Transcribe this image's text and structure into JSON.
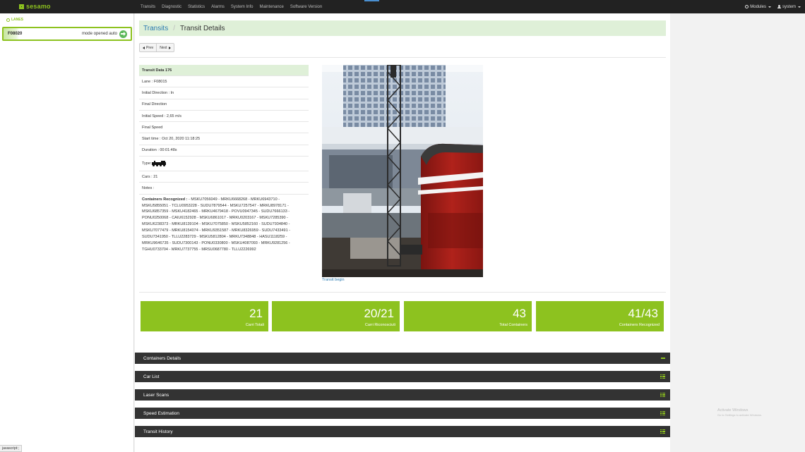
{
  "brand": {
    "name": "sesamo",
    "accent": "#8dc21f"
  },
  "nav": {
    "items": [
      "Transits",
      "Diagnostic",
      "Statistics",
      "Alarms",
      "System Info",
      "Maintenance",
      "Software Version"
    ],
    "modules_label": "Modules",
    "user_label": "system"
  },
  "sidebar": {
    "title": "LANES",
    "lane": {
      "id": "F08020",
      "status": "mode opened auto"
    }
  },
  "breadcrumb": {
    "link": "Transits",
    "current": "Transit Details"
  },
  "pager": {
    "prev": "Prev",
    "next": "Next"
  },
  "details": {
    "header": "Transit Data 176",
    "lane": "Lane : F08015",
    "initial_direction": "Initial Direction : In",
    "final_direction": "Final Direction",
    "initial_speed": "Initial Speed : 2,65 m/s",
    "final_speed": "Final Speed",
    "start_time": "Start time : Oct 20, 2020 11:18:25",
    "duration": "Duration : 00:01:48s",
    "type_label": "Type:",
    "type_icon": "locomotive-icon",
    "cars": "Cars : 21",
    "notes": "Notes :",
    "containers_label": "Containers Recognized :",
    "containers_list": " - MSKU7056049 - MRKU6668268 - MRKU6943710 - MSKU5855051 - TCLU0953228 - SUDU7879544 - MSKU7257547 - MRKU8978171 - MSKU6857359 - MSKU4182465 - MRKU4679418 - POVU0947345 - SUDU7666133 - PONU0250068 - CAIU6152928 - MSKU6861017 - MRKU0203167 - MSKU7285390 - MSKU6238373 - MRKU8139104 - MSKU7075850 - MSKU5852160 - SUDU7934840 - MSKU7077479 - MRKU8154074 - MRKU9351587 - MRKU8326959 - SUDU7433491 - SUDU7341950 - TLLU2283729 - MSKU5812804 - MRKU7348848 - HASU1118259 - MRKU9646735 - SUDU7300143 - PONU0330800 - MSKU4087093 - MRKU9281256 - TGHU0733704 - MRKU7737755 - MRSU0687780 - TLLU2226992"
  },
  "photo": {
    "caption": "Transit begin"
  },
  "stats": [
    {
      "value": "21",
      "label": "Carri Totali"
    },
    {
      "value": "20/21",
      "label": "Carri Riconosciuti"
    },
    {
      "value": "43",
      "label": "Total Containers"
    },
    {
      "value": "41/43",
      "label": "Containers Recognized"
    }
  ],
  "panels": [
    {
      "title": "Containers Details",
      "icon": "minus-icon"
    },
    {
      "title": "Car List",
      "icon": "list-icon"
    },
    {
      "title": "Laser Scans",
      "icon": "list-icon"
    },
    {
      "title": "Speed Estimation",
      "icon": "list-icon"
    },
    {
      "title": "Transit History",
      "icon": "list-icon"
    }
  ],
  "watermark": {
    "line1": "Activate Windows",
    "line2": "Go to Settings to activate Windows."
  },
  "statusbar": "javascript:;"
}
